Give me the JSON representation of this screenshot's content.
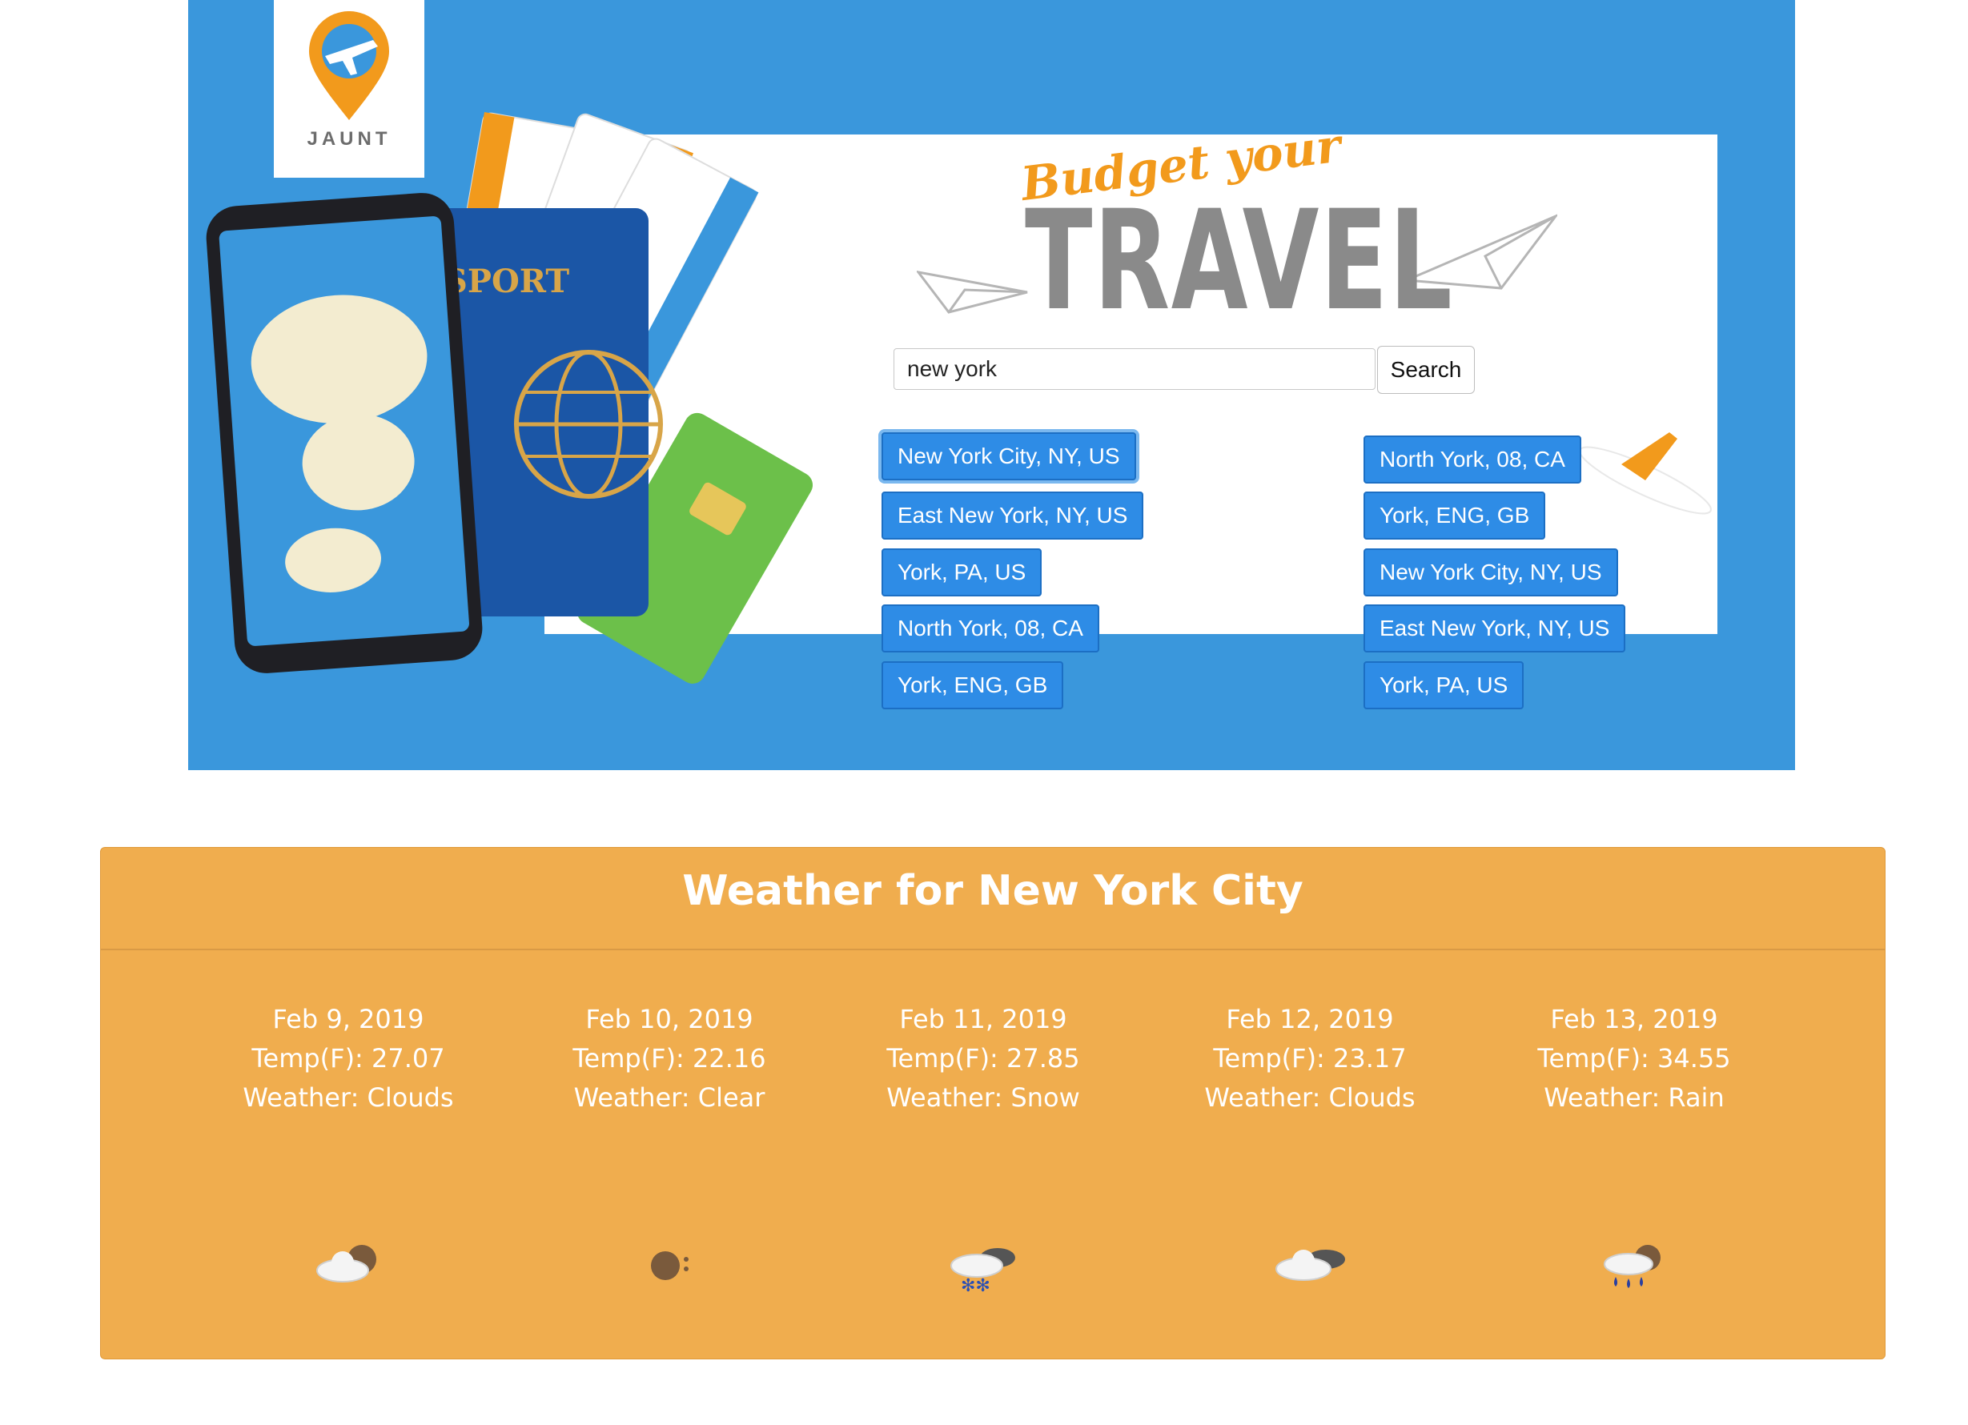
{
  "logo": {
    "text": "JAUNT"
  },
  "hero": {
    "headline_script": "Budget your",
    "headline_main": "TRAVEL"
  },
  "search": {
    "value": "new york",
    "button_label": "Search"
  },
  "results": {
    "left": [
      "New York City, NY, US",
      "East New York, NY, US",
      "York, PA, US",
      "North York, 08, CA",
      "York, ENG, GB"
    ],
    "right": [
      "North York, 08, CA",
      "York, ENG, GB",
      "New York City, NY, US",
      "East New York, NY, US",
      "York, PA, US"
    ]
  },
  "weather": {
    "title": "Weather for New York City",
    "days": [
      {
        "date": "Feb 9, 2019",
        "temp": "Temp(F): 27.07",
        "weather": "Weather: Clouds",
        "icon": "cloud-icon"
      },
      {
        "date": "Feb 10, 2019",
        "temp": "Temp(F): 22.16",
        "weather": "Weather: Clear",
        "icon": "clear-night-icon"
      },
      {
        "date": "Feb 11, 2019",
        "temp": "Temp(F): 27.85",
        "weather": "Weather: Snow",
        "icon": "snow-icon"
      },
      {
        "date": "Feb 12, 2019",
        "temp": "Temp(F): 23.17",
        "weather": "Weather: Clouds",
        "icon": "cloud-icon"
      },
      {
        "date": "Feb 13, 2019",
        "temp": "Temp(F): 34.55",
        "weather": "Weather: Rain",
        "icon": "rain-icon"
      }
    ]
  },
  "colors": {
    "hero_blue": "#3a97dc",
    "button_blue": "#2e8ce6",
    "panel_orange": "#f0ad4e",
    "accent_orange": "#f29a1c"
  }
}
